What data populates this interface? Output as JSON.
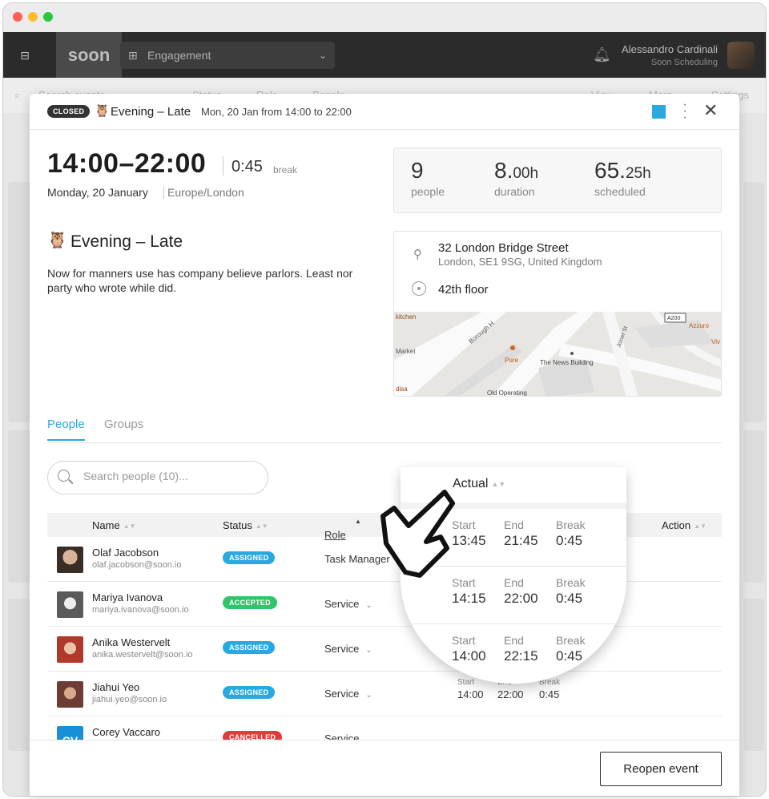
{
  "app": {
    "logo": "soon",
    "selector": "Engagement",
    "user_name": "Alessandro Cardinali",
    "user_org": "Soon Scheduling"
  },
  "background_toolbar": {
    "search_placeholder": "Search events",
    "filters": [
      "Status",
      "Role",
      "People",
      "View",
      "More",
      "Settings"
    ]
  },
  "event": {
    "status_badge": "CLOSED",
    "emoji": "🦉",
    "title": "Evening – Late",
    "header_date": "Mon, 20 Jan from 14:00 to 22:00",
    "color": "#2aa8e0",
    "time_range": "14:00–22:00",
    "break_value": "0:45",
    "break_label": "break",
    "long_date": "Monday, 20 January",
    "timezone": "Europe/London",
    "description": "Now for manners use has company believe parlors. Least nor party who wrote while did."
  },
  "stats": {
    "people_num": "9",
    "people_label": "people",
    "duration_main": "8.",
    "duration_small": "00h",
    "duration_label": "duration",
    "scheduled_main": "65.",
    "scheduled_small": "25h",
    "scheduled_label": "scheduled"
  },
  "location": {
    "address_line1": "32 London Bridge Street",
    "address_line2": "London, SE1 9SG, United Kingdom",
    "floor": "42th floor",
    "map_labels": [
      "kitchen",
      "Borough H",
      "Market",
      "Pure",
      "The News Building",
      "Old Operating",
      "disa",
      "Joiner St",
      "A200",
      "Azzuro",
      "Viv"
    ]
  },
  "tabs": {
    "people": "People",
    "groups": "Groups"
  },
  "search": {
    "placeholder": "Search people (10)..."
  },
  "table": {
    "headers": {
      "name": "Name",
      "status": "Status",
      "role": "Role",
      "actual": "Actual",
      "action": "Action"
    },
    "time_labels": {
      "start": "Start",
      "end": "End",
      "break": "Break"
    },
    "rows": [
      {
        "name": "Olaf Jacobson",
        "email": "olaf.jacobson@soon.io",
        "status": "ASSIGNED",
        "role": "Task Manager"
      },
      {
        "name": "Mariya Ivanova",
        "email": "mariya.ivanova@soon.io",
        "status": "ACCEPTED",
        "role": "Service"
      },
      {
        "name": "Anika Westervelt",
        "email": "anika.westervelt@soon.io",
        "status": "ASSIGNED",
        "role": "Service"
      },
      {
        "name": "Jiahui Yeo",
        "email": "jiahui.yeo@soon.io",
        "status": "ASSIGNED",
        "role": "Service",
        "start": "14:00",
        "end": "22:00",
        "break": "0:45"
      },
      {
        "name": "Corey Vaccaro",
        "initials": "CV",
        "status": "CANCELLED",
        "role": "Service"
      }
    ]
  },
  "magnifier": {
    "title": "Actual",
    "rows": [
      {
        "start": "13:45",
        "end": "21:45",
        "break": "0:45"
      },
      {
        "start": "14:15",
        "end": "22:00",
        "break": "0:45"
      },
      {
        "start": "14:00",
        "end": "22:15",
        "break": "0:45"
      }
    ]
  },
  "footer": {
    "reopen_label": "Reopen event"
  }
}
